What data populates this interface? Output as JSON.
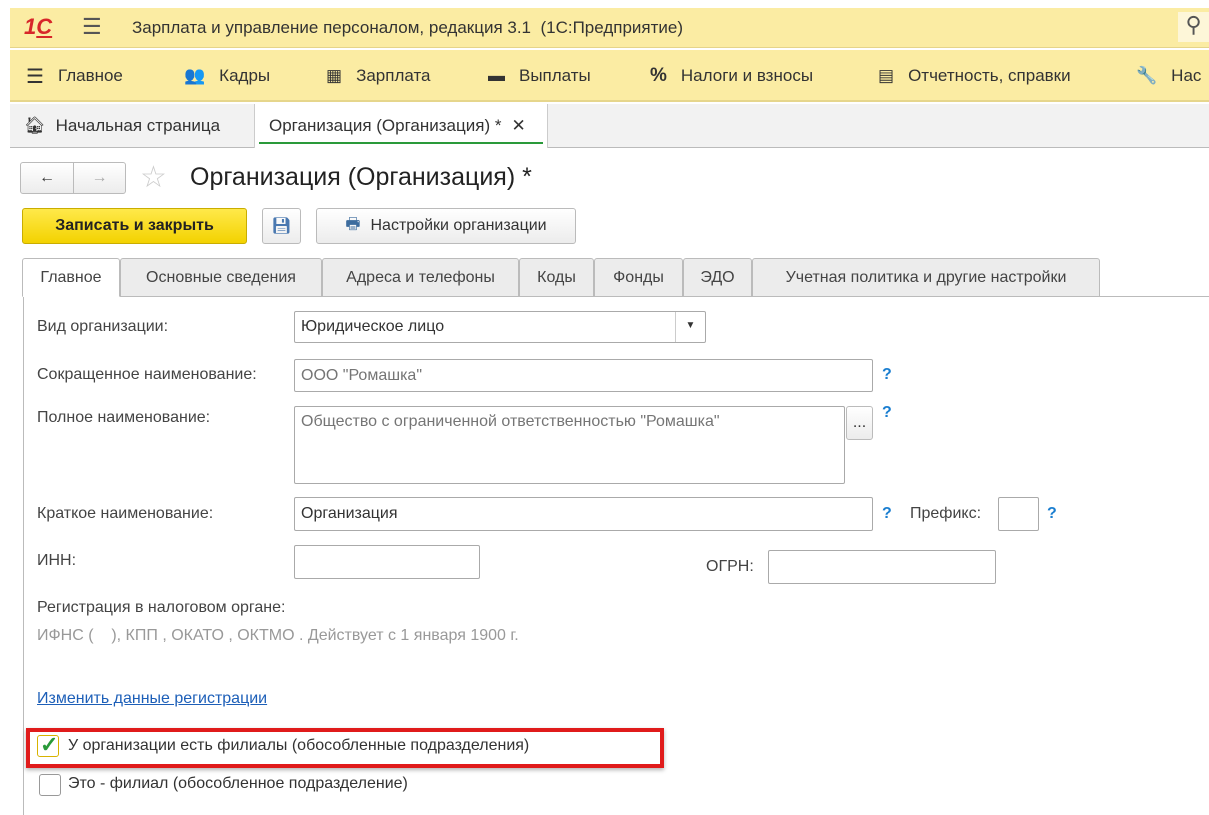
{
  "app": {
    "title": "Зарплата и управление персоналом, редакция 3.1  (1С:Предприятие)"
  },
  "sections": [
    {
      "icon": "menu-icon",
      "label": "Главное"
    },
    {
      "icon": "people-icon",
      "label": "Кадры"
    },
    {
      "icon": "calculator-icon",
      "label": "Зарплата"
    },
    {
      "icon": "card-icon",
      "label": "Выплаты"
    },
    {
      "icon": "percent-icon",
      "label": "Налоги и взносы"
    },
    {
      "icon": "reports-icon",
      "label": "Отчетность, справки"
    },
    {
      "icon": "wrench-icon",
      "label": "Нас"
    }
  ],
  "open_tabs": [
    {
      "label": "Начальная страница"
    },
    {
      "label": "Организация (Организация) *"
    }
  ],
  "form": {
    "title": "Организация (Организация) *",
    "save_close": "Записать и закрыть",
    "settings": "Настройки организации",
    "tabs": [
      "Главное",
      "Основные сведения",
      "Адреса и телефоны",
      "Коды",
      "Фонды",
      "ЭДО",
      "Учетная политика и другие настройки"
    ],
    "fields": {
      "org_type_label": "Вид организации:",
      "org_type_value": "Юридическое лицо",
      "short_name_label": "Сокращенное наименование:",
      "short_name_placeholder": "ООО \"Ромашка\"",
      "full_name_label": "Полное наименование:",
      "full_name_placeholder": "Общество с ограниченной ответственностью \"Ромашка\"",
      "brief_name_label": "Краткое наименование:",
      "brief_name_value": "Организация",
      "prefix_label": "Префикс:",
      "prefix_value": "",
      "inn_label": "ИНН:",
      "inn_value": "",
      "ogrn_label": "ОГРН:",
      "ogrn_value": "",
      "help": "?",
      "ellipsis": "..."
    },
    "registration_label": "Регистрация в налоговом органе:",
    "registration_text": "ИФНС (    ), КПП , ОКАТО , ОКТМО . Действует с 1 января 1900 г.",
    "change_registration_link": "Изменить данные регистрации",
    "has_branches_label": "У организации есть филиалы (обособленные подразделения)",
    "has_branches_checked": true,
    "is_branch_label": "Это - филиал (обособленное подразделение)",
    "is_branch_checked": false
  },
  "colors": {
    "accent_yellow": "#fbe14b",
    "highlight": "#e01b1b",
    "check": "#2a9a3a",
    "link": "#1d5fb8"
  }
}
